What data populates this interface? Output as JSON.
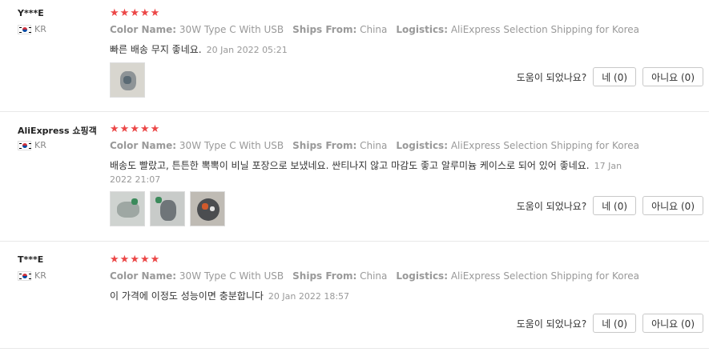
{
  "reviews": [
    {
      "user": "Y***E",
      "country": "KR",
      "stars": 5,
      "attrs": [
        {
          "key": "Color Name:",
          "value": "30W Type C With USB"
        },
        {
          "key": "Ships From:",
          "value": "China"
        },
        {
          "key": "Logistics:",
          "value": "AliExpress Selection Shipping for Korea"
        }
      ],
      "text": "빠른 배송 무지 좋네요.",
      "date": "20 Jan 2022 05:21",
      "helpful_label": "도움이 되었나요?",
      "yes_label": "네 (0)",
      "no_label": "아니요 (0)"
    },
    {
      "user": "AliExpress 쇼핑객",
      "country": "KR",
      "stars": 5,
      "attrs": [
        {
          "key": "Color Name:",
          "value": "30W Type C With USB"
        },
        {
          "key": "Ships From:",
          "value": "China"
        },
        {
          "key": "Logistics:",
          "value": "AliExpress Selection Shipping for Korea"
        }
      ],
      "text": "배송도 빨랐고, 튼튼한 뽁뽁이 비닐 포장으로 보냈네요. 싼티나지 않고 마감도 좋고 알루미늄 케이스로 되어 있어 좋네요.",
      "date": "17 Jan 2022 21:07",
      "helpful_label": "도움이 되었나요?",
      "yes_label": "네 (0)",
      "no_label": "아니요 (0)"
    },
    {
      "user": "T***E",
      "country": "KR",
      "stars": 5,
      "attrs": [
        {
          "key": "Color Name:",
          "value": "30W Type C With USB"
        },
        {
          "key": "Ships From:",
          "value": "China"
        },
        {
          "key": "Logistics:",
          "value": "AliExpress Selection Shipping for Korea"
        }
      ],
      "text": "이 가격에 이정도 성능이면 충분합니다",
      "date": "20 Jan 2022 18:57",
      "helpful_label": "도움이 되었나요?",
      "yes_label": "네 (0)",
      "no_label": "아니요 (0)"
    }
  ],
  "colors": {
    "star": "#ec4747",
    "muted": "#999999"
  },
  "icons": {
    "star": "star-icon",
    "flag": "korea-flag-icon"
  }
}
